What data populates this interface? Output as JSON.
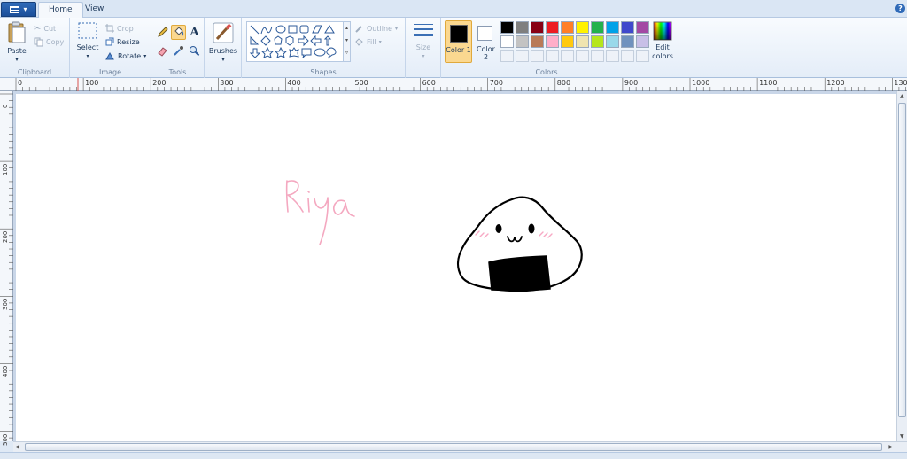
{
  "tabs": [
    {
      "label": "Home",
      "active": true
    },
    {
      "label": "View",
      "active": false
    }
  ],
  "help_glyph": "?",
  "clipboard": {
    "group_label": "Clipboard",
    "paste_label": "Paste",
    "cut_label": "Cut",
    "copy_label": "Copy"
  },
  "image": {
    "group_label": "Image",
    "select_label": "Select",
    "crop_label": "Crop",
    "resize_label": "Resize",
    "rotate_label": "Rotate"
  },
  "tools": {
    "group_label": "Tools",
    "items": [
      "pencil-icon",
      "fill-icon",
      "text-icon",
      "eraser-icon",
      "color-picker-icon",
      "magnifier-icon"
    ],
    "selected": "fill-icon"
  },
  "brushes": {
    "label": "Brushes"
  },
  "shapes": {
    "group_label": "Shapes",
    "outline_label": "Outline",
    "fill_label": "Fill"
  },
  "size": {
    "label": "Size"
  },
  "colors": {
    "group_label": "Colors",
    "color1_label": "Color 1",
    "color2_label": "Color 2",
    "color1": "#000000",
    "color2": "#ffffff",
    "edit_label": "Edit colors",
    "palette": [
      "#000000",
      "#7f7f7f",
      "#880015",
      "#ed1c24",
      "#ff7f27",
      "#fff200",
      "#22b14c",
      "#00a2e8",
      "#3f48cc",
      "#a349a4",
      "#ffffff",
      "#c3c3c3",
      "#b97a57",
      "#ffaec9",
      "#ffc90e",
      "#efe4b0",
      "#b5e61d",
      "#99d9ea",
      "#7092be",
      "#c8bfe7"
    ]
  },
  "ruler": {
    "h_labels": [
      "0",
      "100",
      "200",
      "300",
      "400",
      "500",
      "600",
      "700",
      "800",
      "900",
      "1000",
      "1100",
      "1200",
      "1300"
    ],
    "v_labels": [
      "0",
      "100",
      "200",
      "300",
      "400",
      "500"
    ]
  },
  "canvas": {
    "text": "Riya",
    "text_color": "#f4a8c0",
    "ink_color": "#000000",
    "blush_color": "#f7a9c4"
  }
}
